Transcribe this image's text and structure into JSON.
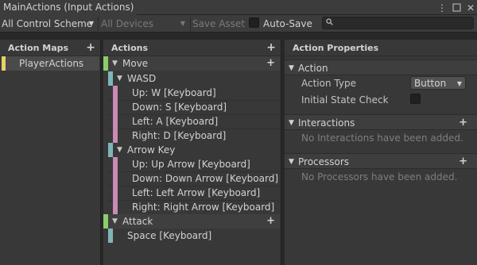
{
  "window": {
    "title": "MainActions (Input Actions)"
  },
  "toolbar": {
    "control_scheme": "All Control Scheme",
    "devices": "All Devices",
    "save_asset": "Save Asset",
    "auto_save": "Auto-Save",
    "auto_save_checked": false,
    "search_value": ""
  },
  "action_maps": {
    "header": "Action Maps",
    "add_symbol": "+",
    "items": [
      {
        "label": "PlayerActions",
        "color": "#e8d068"
      }
    ]
  },
  "actions": {
    "header": "Actions",
    "add_symbol": "+",
    "tree": [
      {
        "label": "Move",
        "kind": "action",
        "color": "#8ccd6a"
      },
      {
        "label": "WASD",
        "kind": "composite",
        "color": "#7fb6b8"
      },
      {
        "label": "Up: W [Keyboard]",
        "kind": "part",
        "color": "#c98ab3"
      },
      {
        "label": "Down: S [Keyboard]",
        "kind": "part",
        "color": "#c98ab3"
      },
      {
        "label": "Left: A [Keyboard]",
        "kind": "part",
        "color": "#c98ab3"
      },
      {
        "label": "Right: D [Keyboard]",
        "kind": "part",
        "color": "#c98ab3"
      },
      {
        "label": "Arrow Key",
        "kind": "composite",
        "color": "#7fb6b8"
      },
      {
        "label": "Up: Up Arrow [Keyboard]",
        "kind": "part",
        "color": "#c98ab3"
      },
      {
        "label": "Down: Down Arrow [Keyboard]",
        "kind": "part",
        "color": "#c98ab3"
      },
      {
        "label": "Left: Left Arrow [Keyboard]",
        "kind": "part",
        "color": "#c98ab3"
      },
      {
        "label": "Right: Right Arrow [Keyboard]",
        "kind": "part",
        "color": "#c98ab3"
      },
      {
        "label": "Attack",
        "kind": "action",
        "color": "#8ccd6a"
      },
      {
        "label": "Space [Keyboard]",
        "kind": "binding",
        "color": "#7fb6b8"
      }
    ]
  },
  "properties": {
    "header": "Action Properties",
    "action_section": {
      "label": "Action",
      "action_type_label": "Action Type",
      "action_type_value": "Button",
      "initial_state_label": "Initial State Check",
      "initial_state_checked": false
    },
    "interactions_section": {
      "label": "Interactions",
      "empty": "No Interactions have been added."
    },
    "processors_section": {
      "label": "Processors",
      "empty": "No Processors have been added."
    }
  },
  "icons": {
    "menu": "more-vertical-icon",
    "maximize": "maximize-icon",
    "close": "close-icon",
    "search": "search-icon",
    "foldout": "triangle-down-icon",
    "add_composite": "add-composite-icon"
  }
}
